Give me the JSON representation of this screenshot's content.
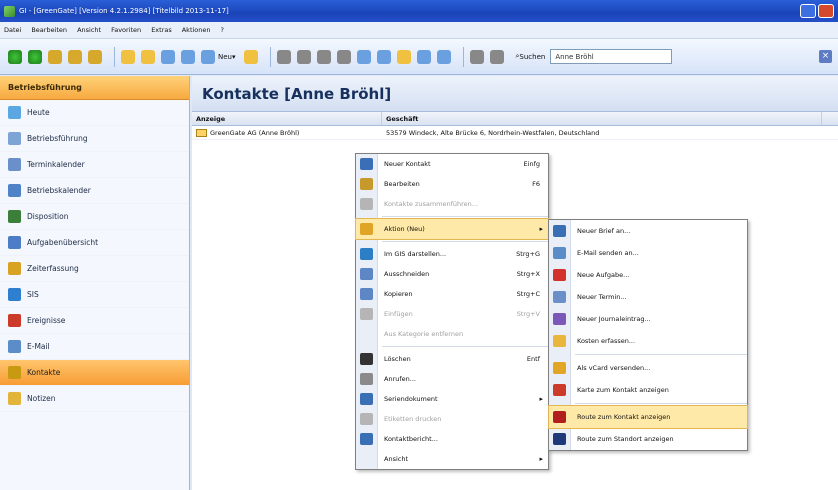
{
  "titlebar": {
    "text": "GI - [GreenGate] [Version 4.2.1.2984] [Titelbild 2013-11-17]"
  },
  "menubar": [
    "Datei",
    "Bearbeiten",
    "Ansicht",
    "Favoriten",
    "Extras",
    "Aktionen",
    "?"
  ],
  "toolbar": {
    "neu_label": "Neu",
    "search_label": "Suchen",
    "search_value": "Anne Bröhl"
  },
  "sidebar": {
    "header": "Betriebsführung",
    "items": [
      {
        "label": "Heute",
        "icon": "today-icon",
        "color": "#5aa7e2"
      },
      {
        "label": "Betriebsführung",
        "icon": "business-icon",
        "color": "#7ea4d6"
      },
      {
        "label": "Terminkalender",
        "icon": "calendar-icon",
        "color": "#6b8fc9"
      },
      {
        "label": "Betriebskalender",
        "icon": "company-calendar-icon",
        "color": "#4f82c6"
      },
      {
        "label": "Disposition",
        "icon": "disposition-icon",
        "color": "#3b7f3a"
      },
      {
        "label": "Aufgabenübersicht",
        "icon": "tasks-icon",
        "color": "#4c7dc6"
      },
      {
        "label": "Zeiterfassung",
        "icon": "time-tracking-icon",
        "color": "#d8a323"
      },
      {
        "label": "SIS",
        "icon": "sis-icon",
        "color": "#2f7fd1"
      },
      {
        "label": "Ereignisse",
        "icon": "events-icon",
        "color": "#cc3b2a"
      },
      {
        "label": "E-Mail",
        "icon": "email-icon",
        "color": "#5a8cc8"
      },
      {
        "label": "Kontakte",
        "icon": "contacts-icon",
        "color": "#c79a12"
      },
      {
        "label": "Notizen",
        "icon": "notes-icon",
        "color": "#e3b43a"
      }
    ],
    "active_index": 10
  },
  "main": {
    "title": "Kontakte [Anne Bröhl]",
    "columns": [
      "Anzeige",
      "Geschäft"
    ],
    "rows": [
      {
        "anzeige": "GreenGate AG  (Anne Bröhl)",
        "geschaeft": "53579 Windeck, Alte Brücke 6, Nordrhein-Westfalen, Deutschland"
      }
    ]
  },
  "context_menu": {
    "items": [
      {
        "label": "Neuer Kontakt",
        "shortcut": "Einfg",
        "disabled": false,
        "icon": "new-contact-icon",
        "color": "#3a6fb5"
      },
      {
        "label": "Bearbeiten",
        "shortcut": "F6",
        "disabled": false,
        "icon": "edit-icon",
        "color": "#c59a2a"
      },
      {
        "label": "Kontakte zusammenführen...",
        "shortcut": "",
        "disabled": true,
        "icon": "merge-icon",
        "color": "#b5b5b5"
      },
      {
        "label": "Aktion (Neu)",
        "shortcut": "",
        "submenu": true,
        "highlight": true,
        "icon": "action-icon",
        "color": "#e0a427"
      },
      {
        "label": "Im GIS darstellen...",
        "shortcut": "Strg+G",
        "disabled": false,
        "icon": "globe-icon",
        "color": "#2c7fc4"
      },
      {
        "label": "Ausschneiden",
        "shortcut": "Strg+X",
        "disabled": false,
        "icon": "cut-icon",
        "color": "#5d86c4"
      },
      {
        "label": "Kopieren",
        "shortcut": "Strg+C",
        "disabled": false,
        "icon": "copy-icon",
        "color": "#5d86c4"
      },
      {
        "label": "Einfügen",
        "shortcut": "Strg+V",
        "disabled": true,
        "icon": "paste-icon",
        "color": "#b5b5b5"
      },
      {
        "label": "Aus Kategorie entfernen",
        "shortcut": "",
        "disabled": true,
        "icon": "",
        "color": ""
      },
      {
        "label": "Löschen",
        "shortcut": "Entf",
        "disabled": false,
        "icon": "delete-icon",
        "color": "#333333"
      },
      {
        "label": "Anrufen...",
        "shortcut": "",
        "disabled": false,
        "icon": "phone-icon",
        "color": "#8a8a8a"
      },
      {
        "label": "Seriendokument",
        "shortcut": "",
        "submenu": true,
        "disabled": false,
        "icon": "serial-doc-icon",
        "color": "#3a6fb5"
      },
      {
        "label": "Etiketten drucken",
        "shortcut": "",
        "disabled": true,
        "icon": "label-print-icon",
        "color": "#b5b5b5"
      },
      {
        "label": "Kontaktbericht...",
        "shortcut": "",
        "disabled": false,
        "icon": "report-icon",
        "color": "#3a6fb5"
      },
      {
        "label": "Ansicht",
        "shortcut": "",
        "submenu": true,
        "disabled": false,
        "icon": "",
        "color": ""
      }
    ]
  },
  "submenu": {
    "items": [
      {
        "label": "Neuer Brief an...",
        "icon": "letter-icon",
        "color": "#3a6fb5"
      },
      {
        "label": "E-Mail senden an...",
        "icon": "email-send-icon",
        "color": "#5a8cc8"
      },
      {
        "label": "Neue Aufgabe...",
        "icon": "task-icon",
        "color": "#d2322a"
      },
      {
        "label": "Neuer Termin...",
        "icon": "appointment-icon",
        "color": "#6b8fc9"
      },
      {
        "label": "Neuer Journaleintrag...",
        "icon": "journal-icon",
        "color": "#7b57b8"
      },
      {
        "label": "Kosten erfassen...",
        "icon": "costs-icon",
        "color": "#e7b63b"
      },
      {
        "label": "Als vCard versenden...",
        "icon": "vcard-icon",
        "color": "#e1a625"
      },
      {
        "label": "Karte zum Kontakt anzeigen",
        "icon": "map-pin-icon",
        "color": "#cc3b2a"
      },
      {
        "label": "Route zum Kontakt anzeigen",
        "icon": "route-flag-icon",
        "color": "#b21e1e",
        "highlight": true
      },
      {
        "label": "Route zum Standort anzeigen",
        "icon": "route-location-icon",
        "color": "#1f3a7a"
      }
    ]
  }
}
